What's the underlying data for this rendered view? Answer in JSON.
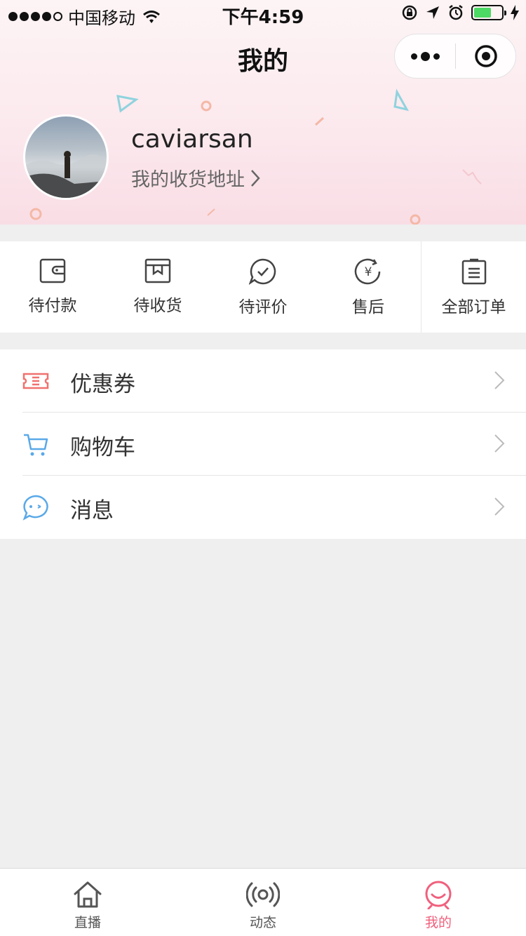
{
  "status_bar": {
    "carrier": "中国移动",
    "time": "下午4:59"
  },
  "nav": {
    "title": "我的"
  },
  "profile": {
    "username": "caviarsan",
    "address_link": "我的收货地址"
  },
  "orders": [
    {
      "label": "待付款",
      "icon": "wallet-icon"
    },
    {
      "label": "待收货",
      "icon": "package-icon"
    },
    {
      "label": "待评价",
      "icon": "review-icon"
    },
    {
      "label": "售后",
      "icon": "refund-icon"
    },
    {
      "label": "全部订单",
      "icon": "order-list-icon"
    }
  ],
  "menu": [
    {
      "label": "优惠券",
      "icon": "coupon-icon",
      "color": "#f0716f"
    },
    {
      "label": "购物车",
      "icon": "cart-icon",
      "color": "#5aa9e8"
    },
    {
      "label": "消息",
      "icon": "message-icon",
      "color": "#5aa9e8"
    }
  ],
  "tabbar": [
    {
      "label": "直播",
      "icon": "home-icon",
      "active": false
    },
    {
      "label": "动态",
      "icon": "broadcast-icon",
      "active": false
    },
    {
      "label": "我的",
      "icon": "smile-icon",
      "active": true
    }
  ],
  "colors": {
    "accent": "#f0607d",
    "header_bg": "#fbe8ed",
    "page_bg": "#efefef"
  }
}
